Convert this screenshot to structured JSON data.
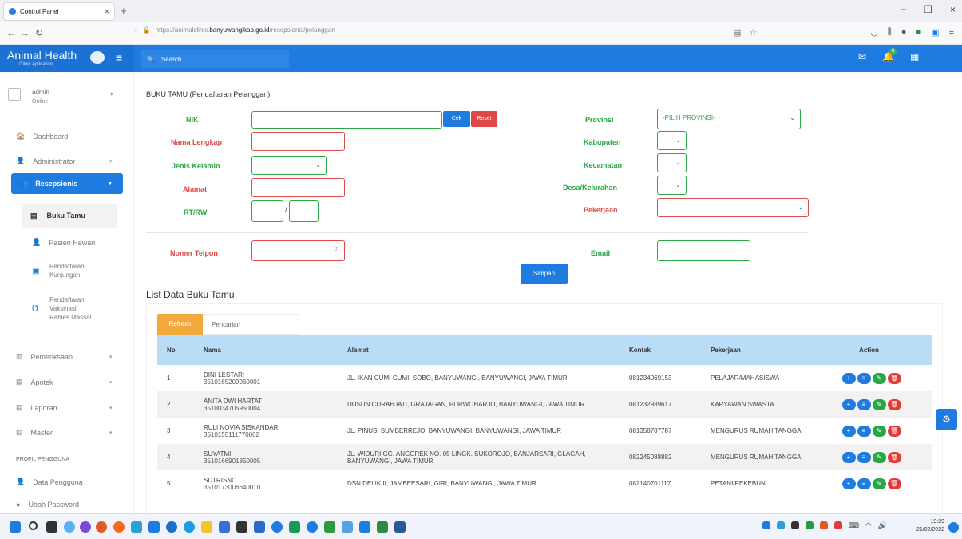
{
  "browser": {
    "tab_title": "Control Panel",
    "url_prefix": "https://animalclinic.",
    "url_domain": "banyuwangikab.go.id",
    "url_path": "/resepsionis/pelanggan"
  },
  "header": {
    "brand": "Animal Health",
    "brand_sub": "Clinic Aplication",
    "search_placeholder": "Search...",
    "notif_count": "0"
  },
  "user": {
    "name": "admin",
    "status": "Online"
  },
  "sidebar": {
    "dashboard": "Dashboard",
    "administrator": "Administrator",
    "resepsionis": "Resepsionis",
    "buku_tamu": "Buku Tamu",
    "pasien_hewan": "Pasien Hewan",
    "pendaftaran_kunjungan_1": "Pendaftaran",
    "pendaftaran_kunjungan_2": "Kunjungan",
    "vaksinasi_1": "Pendaftaran",
    "vaksinasi_2": "Vaksinasi",
    "vaksinasi_3": "Rabies Massal",
    "pemeriksaan": "Pemeriksaan",
    "apotek": "Apotek",
    "laporan": "Laporan",
    "master": "Master",
    "profil_heading": "PROFIL PENGGUNA",
    "data_pengguna": "Data Pengguna",
    "ubah_password": "Ubah Password"
  },
  "form": {
    "title": "BUKU TAMU (Pendaftaran Pelanggan)",
    "nik": "NIK",
    "cek": "Cek",
    "reset": "Reset",
    "nama": "Nama Lengkap",
    "jenis_kelamin": "Jenis Kelamin",
    "alamat": "Alamat",
    "rtrw": "RT/RW",
    "rtrw_sep": "/",
    "telp": "Nomer Telpon",
    "provinsi": "Provinsi",
    "provinsi_value": "-PILIH PROVINSI-",
    "kabupaten": "Kabupaten",
    "kecamatan": "Kecamatan",
    "desa": "Desa/Kelurahan",
    "pekerjaan": "Pekerjaan",
    "email": "Email",
    "simpan": "Simpan"
  },
  "list": {
    "title": "List Data Buku Tamu",
    "tab_refresh": "Refresh",
    "tab_pencarian": "Pencarian",
    "columns": [
      "No",
      "Nama",
      "Alamat",
      "Kontak",
      "Pekerjaan",
      "Action"
    ],
    "rows": [
      {
        "no": "1",
        "nama": "DINI LESTARI",
        "nik": "3510165209960001",
        "alamat": "JL. IKAN CUMI-CUMI, SOBO, BANYUWANGI, BANYUWANGI, JAWA TIMUR",
        "kontak": "081234069153",
        "pekerjaan": "PELAJAR/MAHASISWA"
      },
      {
        "no": "2",
        "nama": "ANITA DWI HARTATI",
        "nik": "3510034705950004",
        "alamat": "DUSUN CURAHJATI, GRAJAGAN, PURWOHARJO, BANYUWANGI, JAWA TIMUR",
        "kontak": "081232939617",
        "pekerjaan": "KARYAWAN SWASTA"
      },
      {
        "no": "3",
        "nama": "RULI NOVIA SISKANDARI",
        "nik": "3510155111770002",
        "alamat": "JL. PINUS, SUMBERREJO, BANYUWANGI, BANYUWANGI, JAWA TIMUR",
        "kontak": "081358787787",
        "pekerjaan": "MENGURUS RUMAH TANGGA"
      },
      {
        "no": "4",
        "nama": "SUYATMI",
        "nik": "3510166901850005",
        "alamat": "JL. WIDURI GG. ANGGREK NO. 05 LINGK. SUKOROJO, BANJARSARI, GLAGAH, BANYUWANGI, JAWA TIMUR",
        "kontak": "082245088882",
        "pekerjaan": "MENGURUS RUMAH TANGGA"
      },
      {
        "no": "5",
        "nama": "SUTRISNO",
        "nik": "3510173006640010",
        "alamat": "DSN DELIK II, JAMBEESARI, GIRI, BANYUWANGI, JAWA TIMUR",
        "kontak": "082140701117",
        "pekerjaan": "PETANI/PEKEBUN"
      }
    ]
  },
  "taskbar": {
    "time": "19:29",
    "date": "21/02/2022"
  }
}
